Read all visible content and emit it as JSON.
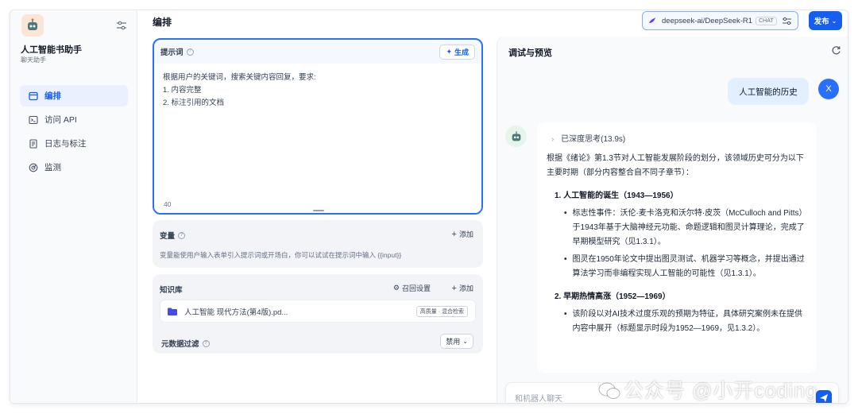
{
  "sidebar": {
    "app_name": "人工智能书助手",
    "app_type": "聊天助手",
    "items": [
      {
        "label": "编排",
        "icon": "layout-icon",
        "active": true
      },
      {
        "label": "访问 API",
        "icon": "terminal-icon",
        "active": false
      },
      {
        "label": "日志与标注",
        "icon": "log-icon",
        "active": false
      },
      {
        "label": "监测",
        "icon": "monitor-icon",
        "active": false
      }
    ]
  },
  "header": {
    "title": "编排",
    "model_name": "deepseek-ai/DeepSeek-R1",
    "model_badge": "CHAT",
    "publish_label": "发布"
  },
  "prompt": {
    "label": "提示词",
    "generate_label": "生成",
    "lines": [
      "根据用户的关键词，搜索关键内容回复，要求:",
      "1. 内容完整",
      "2. 标注引用的文档"
    ],
    "char_count": "40"
  },
  "variables": {
    "label": "变量",
    "add_label": "添加",
    "description": "变量能使用户输入表单引入提示词或开场白，你可以试试在提示词中输入 {{input}}"
  },
  "knowledge": {
    "label": "知识库",
    "recall_label": "召回设置",
    "add_label": "添加",
    "item_name": "人工智能 现代方法(第4版).pd...",
    "item_mode": "高质量 · 混合检索",
    "meta_label": "元数据过滤",
    "meta_value": "禁用"
  },
  "preview": {
    "title": "调试与预览",
    "user_message": "人工智能的历史",
    "user_initial": "X",
    "think_label": "已深度思考(13.9s)",
    "intro": "根据《绪论》第1.3节对人工智能发展阶段的划分，该领域历史可分为以下主要时期（部分内容整合自不同子章节）：",
    "section1_title": "1. 人工智能的诞生（1943—1956）",
    "section1_bullets": [
      "标志性事件：沃伦·麦卡洛克和沃尔特·皮茨（McCulloch and Pitts）于1943年基于大脑神经元功能、命题逻辑和图灵计算理论，完成了早期模型研究（见1.3.1）。",
      "图灵在1950年论文中提出图灵测试、机器学习等概念，并提出通过算法学习而非编程实现人工智能的可能性（见1.3.1）。"
    ],
    "section2_title": "2. 早期热情高涨（1952—1969）",
    "section2_bullets": [
      "该阶段以对AI技术过度乐观的预期为特征，具体研究案例未在提供内容中展开（标题显示时段为1952—1969，见1.3.2）。"
    ],
    "input_placeholder": "和机器人聊天"
  },
  "watermark": "公众号 @小开coding",
  "colors": {
    "accent": "#155eef",
    "user_bubble": "#e1effe",
    "sidebar_active": "#eaf0fe"
  }
}
